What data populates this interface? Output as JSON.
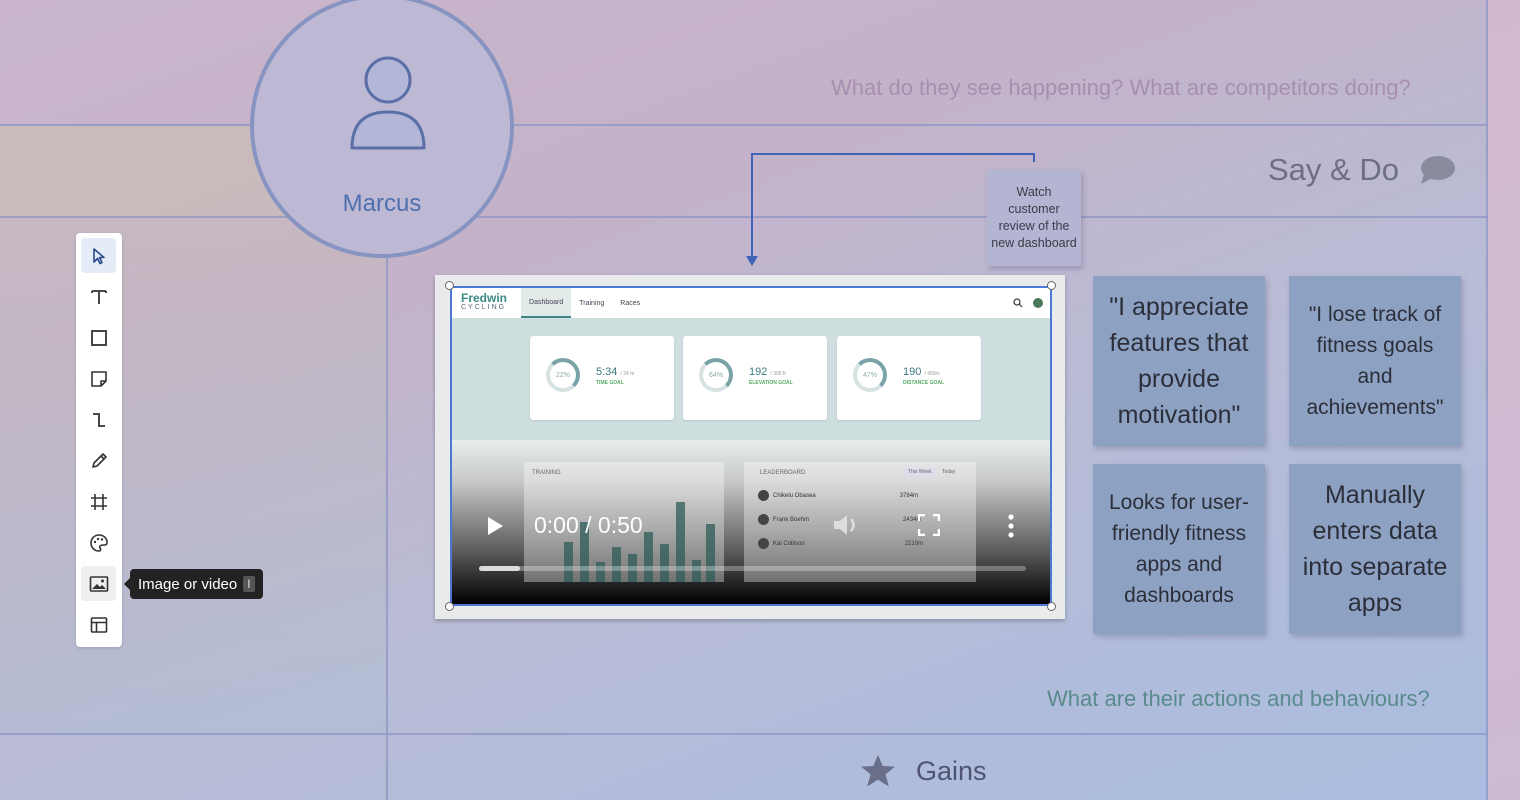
{
  "prompts": {
    "see": "What do they see happening? What are competitors doing?",
    "actions": "What are their actions and behaviours?"
  },
  "persona": {
    "name": "Marcus",
    "icon": "user-icon"
  },
  "section": {
    "title": "Say & Do",
    "icon": "speech-bubble-icon"
  },
  "small_note": "Watch customer review of the new dashboard",
  "sticky_notes": [
    "\"I appreciate features that provide motivation\"",
    "\"I lose track of fitness goals and achievements\"",
    "Looks for user-friendly fitness apps and dashboards",
    "Manually enters data into separate apps"
  ],
  "video": {
    "time": "0:00 / 0:50",
    "progress": 0.075,
    "app": {
      "logo": "Fredwin",
      "logo_sub": "CYCLING",
      "tabs": [
        "Dashboard",
        "Training",
        "Races"
      ],
      "cards": [
        {
          "pct": "22%",
          "value": "5:34",
          "unit": "/ 24 hr",
          "label": "TIME GOAL"
        },
        {
          "pct": "64%",
          "value": "192",
          "unit": "/ 300 ft",
          "label": "ELEVATION GOAL"
        },
        {
          "pct": "47%",
          "value": "190",
          "unit": "/ 400m",
          "label": "DISTANCE GOAL"
        }
      ],
      "training_label": "TRAINING",
      "leaderboard_label": "LEADERBOARD",
      "leaderboard_tabs": [
        "This Week",
        "Today"
      ],
      "leaders": [
        {
          "name": "Chikelu Obasea",
          "value": "3784m"
        },
        {
          "name": "Frank Boehm",
          "value": "2434m"
        },
        {
          "name": "Kai Collison",
          "value": "2210m"
        }
      ]
    }
  },
  "toolbar": {
    "tools": [
      "select-tool",
      "text-tool",
      "shape-tool",
      "sticky-note-tool",
      "connector-tool",
      "pen-tool",
      "frame-tool",
      "sticker-tool",
      "image-video-tool",
      "template-tool"
    ],
    "tooltip": "Image or video",
    "shortcut": "I"
  },
  "gains": {
    "label": "Gains",
    "icon": "star-icon"
  }
}
